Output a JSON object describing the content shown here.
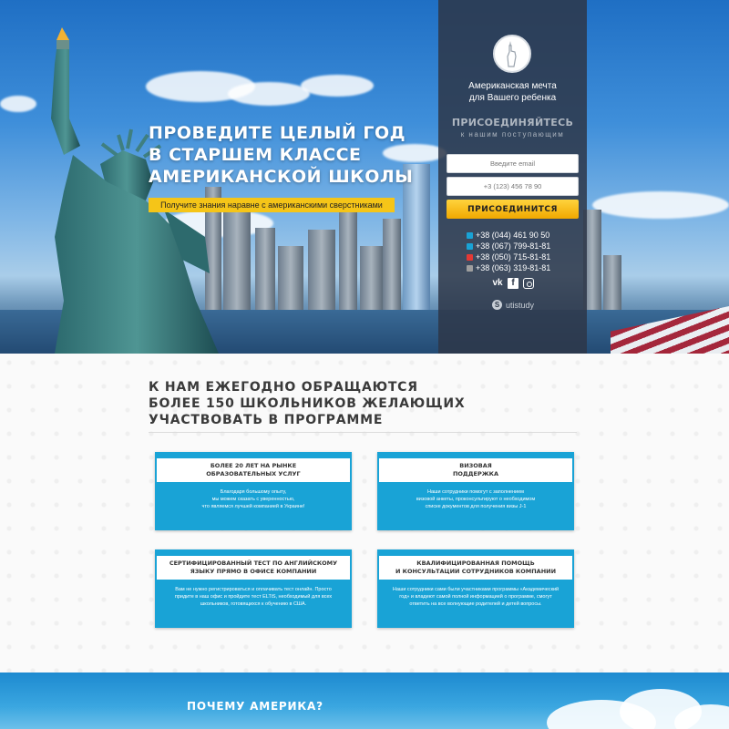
{
  "hero": {
    "title_lines": [
      "ПРОВЕДИТЕ ЦЕЛЫЙ ГОД",
      "В СТАРШЕМ КЛАССЕ",
      "АМЕРИКАНСКОЙ ШКОЛЫ"
    ],
    "subtitle": "Получите знания наравне с американскими сверстниками"
  },
  "panel": {
    "tagline_lines": [
      "Американская мечта",
      "для Вашего ребенка"
    ],
    "join_title": "ПРИСОЕДИНЯЙТЕСЬ",
    "join_sub": "к нашим поступающим",
    "email_placeholder": "Введите email",
    "phone_placeholder": "+3 (123) 456 78 90",
    "join_button": "ПРИСОЕДИНИТСЯ",
    "phones": [
      {
        "number": "+38 (044) 461 90 50",
        "icon": "phone-icon",
        "color": "#19a3d6"
      },
      {
        "number": "+38 (067) 799-81-81",
        "icon": "kyivstar-icon",
        "color": "#19a3d6"
      },
      {
        "number": "+38 (050) 715-81-81",
        "icon": "vodafone-icon",
        "color": "#e53935"
      },
      {
        "number": "+38 (063) 319-81-81",
        "icon": "lifecell-icon",
        "color": "#9e9e9e"
      }
    ],
    "socials": [
      "vk-icon",
      "facebook-icon",
      "instagram-icon"
    ],
    "skype": "utistudy"
  },
  "info": {
    "title_lines": [
      "К НАМ ЕЖЕГОДНО ОБРАЩАЮТСЯ",
      "БОЛЕЕ 150 ШКОЛЬНИКОВ ЖЕЛАЮЩИХ",
      "УЧАСТВОВАТЬ В ПРОГРАММЕ"
    ],
    "cards": [
      {
        "title_lines": [
          "БОЛЕЕ 20 ЛЕТ НА РЫНКЕ",
          "ОБРАЗОВАТЕЛЬНЫХ УСЛУГ"
        ],
        "text_lines": [
          "Благодаря большому опыту,",
          "мы можем сказать с уверенностью,",
          "что являемся лучшей компанией в Украине!"
        ]
      },
      {
        "title_lines": [
          "ВИЗОВАЯ",
          "ПОДДЕРЖКА"
        ],
        "text_lines": [
          "Наши сотрудники помогут с заполнением",
          "визовой анкеты, проконсультируют о необходимом",
          "списке документов для получения визы J-1"
        ]
      },
      {
        "title_lines": [
          "СЕРТИФИЦИРОВАННЫЙ ТЕСТ ПО АНГЛИЙСКОМУ",
          "ЯЗЫКУ ПРЯМО В ОФИСЕ КОМПАНИИ"
        ],
        "text_lines": [
          "Вам не нужно регистрироваться и оплачивать тест онлайн. Просто",
          "придите в наш офис и пройдите тест ELTiS, необходимый для всех",
          "школьников, готовящихся к обучению в США."
        ]
      },
      {
        "title_lines": [
          "КВАЛИФИЦИРОВАННАЯ ПОМОЩЬ",
          "И КОНСУЛЬТАЦИИ СОТРУДНИКОВ КОМПАНИИ"
        ],
        "text_lines": [
          "Наши сотрудники сами были участниками программы «Академический",
          "год» и владеют самой полной информацией о программе, смогут",
          "ответить на все волнующие родителей и детей вопросы."
        ]
      }
    ]
  },
  "why": {
    "title": "ПОЧЕМУ АМЕРИКА?"
  }
}
